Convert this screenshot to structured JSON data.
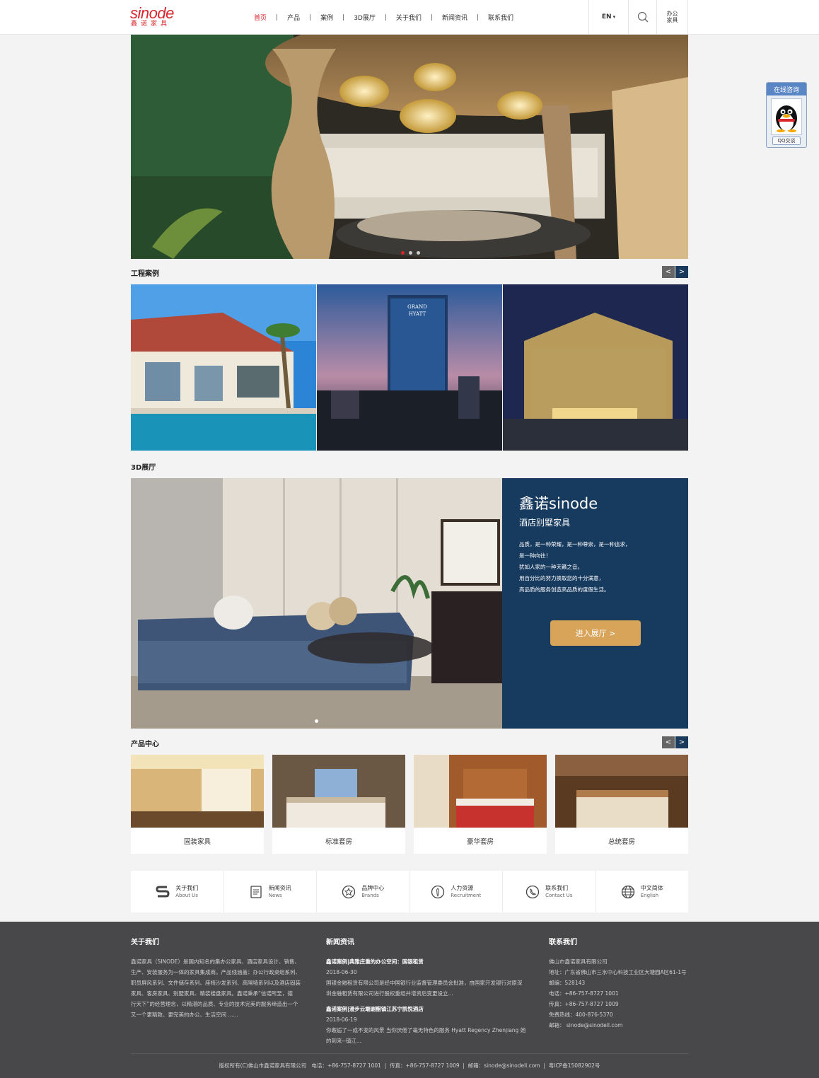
{
  "header": {
    "logo_en": "sinode",
    "logo_cn": "鑫诺家具",
    "nav": [
      {
        "label": "首页"
      },
      {
        "label": "产品"
      },
      {
        "label": "案例"
      },
      {
        "label": "3D展厅"
      },
      {
        "label": "关于我们"
      },
      {
        "label": "新闻资讯"
      },
      {
        "label": "联系我们"
      }
    ],
    "nav_separator": "|",
    "lang": "EN",
    "lang_arrow": "▾",
    "office_line1": "办公",
    "office_line2": "家具"
  },
  "banner": {
    "slides": 3,
    "active_slide": 1
  },
  "cases_section": {
    "title": "工程案例",
    "prev": "<",
    "next": ">"
  },
  "showroom_section": {
    "title": "3D展厅",
    "brand": "鑫诺sinode",
    "subtitle": "酒店别墅家具",
    "desc": [
      "品质，是一种荣耀，是一种尊崇，是一种追求，",
      "是一种向往！",
      "犹如人家的一种天籁之音。",
      "用百分比的努力换取您的十分满意，",
      "高品质的服务创造高品质的度假生活。"
    ],
    "button": "进入展厅 >"
  },
  "products_section": {
    "title": "产品中心",
    "prev": "<",
    "next": ">",
    "items": [
      {
        "label": "固装家具"
      },
      {
        "label": "标准套房"
      },
      {
        "label": "豪华套房"
      },
      {
        "label": "总统套房"
      }
    ]
  },
  "quick_links": [
    {
      "cn": "关于我们",
      "en": "About Us",
      "icon": "sinode-s-icon"
    },
    {
      "cn": "新闻资讯",
      "en": "News",
      "icon": "document-icon"
    },
    {
      "cn": "品牌中心",
      "en": "Brands",
      "icon": "star-badge-icon"
    },
    {
      "cn": "人力资源",
      "en": "Recruitment",
      "icon": "person-tie-icon"
    },
    {
      "cn": "联系我们",
      "en": "Contact Us",
      "icon": "phone-icon"
    },
    {
      "cn": "中文简体",
      "en": "English",
      "icon": "globe-icon"
    }
  ],
  "footer": {
    "about": {
      "title": "关于我们",
      "lines": [
        "鑫诺家具（SINODE）是国内知名的集办公家具、酒店家具设计、销售、",
        "生产、安装服务为一体的家具集成商。产品线涵盖：办公行政桌组系列、",
        "职员屏风系列、文件储存系列、座椅沙发系列、高隔墙系列以及酒店固装",
        "家具、客房家具、别墅家具、精装楼盘家具。鑫诺秉承“信诺所至，德",
        "行天下”的经营理念，以精湛的品质、专业的技术完美的服务缔造出一个",
        "又一个更精致、更完美的办公、生活空间 ......"
      ]
    },
    "news": {
      "title": "新闻资讯",
      "items": [
        {
          "title": "鑫诺案例|典雅庄重的办公空间：国银租赁",
          "date": "2018-06-30",
          "lines": [
            "国银金融租赁有限公司是经中国银行业监督管理委员会批准，由国家开发银行对原深",
            "圳金融租赁有限公司进行股权重组并增资后变更设立..."
          ]
        },
        {
          "title": "鑫诺案例|漫步云端谢醋镇江苏宁凯悦酒店",
          "date": "2018-06-19",
          "lines": [
            "你邂逅了一成不变的风景 当你厌倦了毫无特色的服务 Hyatt Regency Zhenjiang 她",
            "的到来--镇江..."
          ]
        }
      ]
    },
    "contact": {
      "title": "联系我们",
      "lines": [
        "佛山市鑫诺家具有限公司",
        "地址：广东省佛山市三水中心科技工业区大塘园A区61-1号",
        "邮编：528143",
        "电话：+86-757-8727 1001",
        "传真：+86-757-8727 1009",
        "免费热线：400-876-5370",
        "邮箱： sinode@sinodell.com"
      ]
    },
    "copyright": "版权所有(C)佛山市鑫诺家具有限公司   电话：+86-757-8727 1001  |  传真：+86-757-8727 1009  |  邮箱：sinode@sinodell.com  |  粤ICP备15082902号"
  },
  "qq": {
    "title": "在线咨询",
    "button": "QQ交谈"
  },
  "colors": {
    "brand_red": "#d7262c",
    "showroom_blue": "#173a5f",
    "button_gold": "#d8a45a",
    "footer_bg": "#48474a"
  }
}
